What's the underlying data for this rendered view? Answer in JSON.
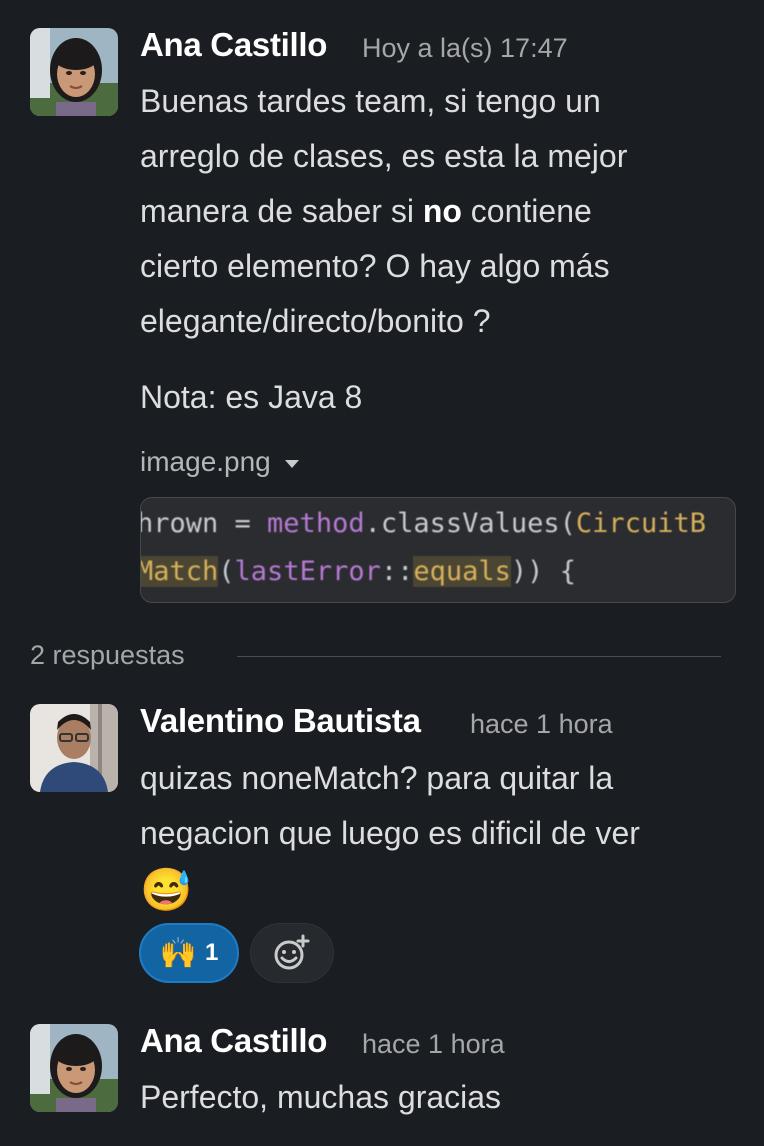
{
  "messages": [
    {
      "author": "Ana Castillo",
      "time": "Hoy a la(s) 17:47",
      "lines": [
        "Buenas tardes team, si tengo un",
        "arreglo de clases, es esta la mejor",
        "manera de saber si ",
        "no",
        " contiene",
        "cierto elemento? O hay algo más",
        "elegante/directo/bonito ?"
      ],
      "note": "Nota: es Java 8",
      "attachment": {
        "filename": "image.png",
        "code_line_1_parts": [
          "hrown = ",
          "method",
          ".classValues(",
          "CircuitB"
        ],
        "code_line_2_parts": [
          "Match",
          "(",
          "lastError",
          "::",
          "equals",
          ")) {"
        ]
      }
    },
    {
      "author": "Valentino Bautista",
      "time": "hace 1 hora",
      "lines": [
        "quizas noneMatch? para quitar la",
        "negacion que luego es dificil de ver"
      ],
      "emoji": "😅",
      "reaction": {
        "emoji": "🙌",
        "count": "1"
      }
    },
    {
      "author": "Ana Castillo",
      "time": "hace 1 hora",
      "lines": [
        "Perfecto, muchas gracias"
      ]
    }
  ],
  "thread": {
    "replies_label": "2 respuestas"
  },
  "colors": {
    "background": "#1a1d21",
    "reaction_active": "#1264a3"
  },
  "icons": [
    "add-reaction-icon",
    "dropdown-caret-icon"
  ]
}
